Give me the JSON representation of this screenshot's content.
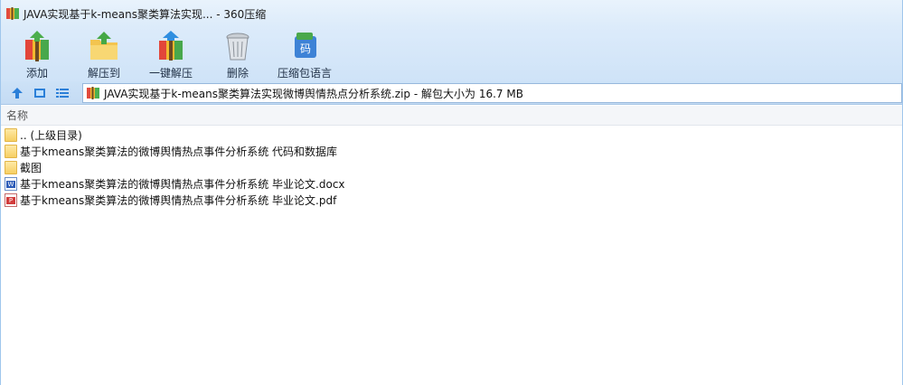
{
  "window": {
    "title": "JAVA实现基于k-means聚类算法实现... - 360压缩"
  },
  "toolbar": {
    "items": [
      {
        "label": "添加",
        "icon": "add-archive-icon"
      },
      {
        "label": "解压到",
        "icon": "extract-to-icon"
      },
      {
        "label": "一键解压",
        "icon": "one-click-extract-icon"
      },
      {
        "label": "删除",
        "icon": "delete-icon"
      },
      {
        "label": "压缩包语言",
        "icon": "archive-language-icon"
      }
    ]
  },
  "navbar": {
    "address": "JAVA实现基于k-means聚类算法实现微博舆情热点分析系统.zip - 解包大小为 16.7 MB"
  },
  "list": {
    "column_name": "名称",
    "rows": [
      {
        "name": ".. (上级目录)",
        "type": "folder"
      },
      {
        "name": "基于kmeans聚类算法的微博舆情热点事件分析系统 代码和数据库",
        "type": "folder"
      },
      {
        "name": "截图",
        "type": "folder"
      },
      {
        "name": "基于kmeans聚类算法的微博舆情热点事件分析系统 毕业论文.docx",
        "type": "docx"
      },
      {
        "name": "基于kmeans聚类算法的微博舆情热点事件分析系统 毕业论文.pdf",
        "type": "pdf"
      }
    ]
  },
  "colors": {
    "accent": "#2b7fd8",
    "titlebar": "#dcebfa",
    "toolbar": "#cfe3f8"
  }
}
